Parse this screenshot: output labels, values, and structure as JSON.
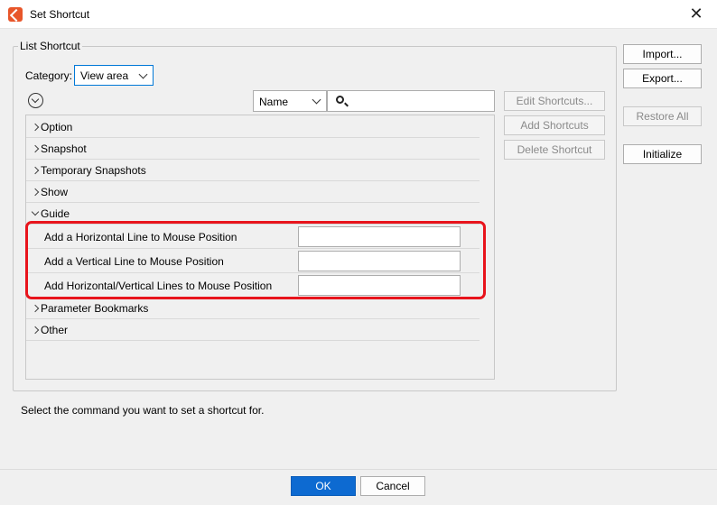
{
  "window": {
    "title": "Set Shortcut",
    "icon": "app-logo-icon",
    "close_glyph": "✕"
  },
  "group": {
    "legend": "List Shortcut"
  },
  "category": {
    "label": "Category:",
    "value": "View area"
  },
  "sort": {
    "value": "Name"
  },
  "search": {
    "value": "",
    "icon": "search-icon"
  },
  "tree": {
    "items": [
      {
        "label": "Option",
        "expanded": false
      },
      {
        "label": "Snapshot",
        "expanded": false
      },
      {
        "label": "Temporary Snapshots",
        "expanded": false
      },
      {
        "label": "Show",
        "expanded": false
      },
      {
        "label": "Guide",
        "expanded": true
      },
      {
        "label": "Parameter Bookmarks",
        "expanded": false
      },
      {
        "label": "Other",
        "expanded": false
      }
    ],
    "guide_commands": [
      {
        "label": "Add a Horizontal Line to Mouse Position",
        "shortcut": ""
      },
      {
        "label": "Add a Vertical Line to Mouse Position",
        "shortcut": ""
      },
      {
        "label": "Add Horizontal/Vertical Lines to Mouse Position",
        "shortcut": ""
      }
    ]
  },
  "buttons": {
    "edit_shortcuts": "Edit Shortcuts...",
    "add_shortcuts": "Add Shortcuts",
    "delete_shortcut": "Delete Shortcut",
    "import": "Import...",
    "export": "Export...",
    "restore_all": "Restore All",
    "initialize": "Initialize",
    "ok": "OK",
    "cancel": "Cancel"
  },
  "hint": "Select the command you want to set a shortcut for.",
  "colors": {
    "accent": "#0d6ad1",
    "highlight": "#e8141c",
    "app_icon": "#e8562a"
  }
}
